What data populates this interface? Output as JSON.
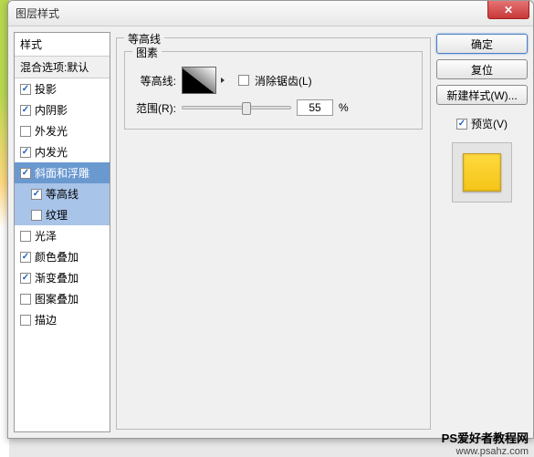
{
  "window": {
    "title": "图层样式"
  },
  "sidebar": {
    "header": "样式",
    "blend_header": "混合选项:默认",
    "items": [
      {
        "label": "投影",
        "checked": true
      },
      {
        "label": "内阴影",
        "checked": true
      },
      {
        "label": "外发光",
        "checked": false
      },
      {
        "label": "内发光",
        "checked": true
      },
      {
        "label": "斜面和浮雕",
        "checked": true,
        "selected": true
      },
      {
        "label": "等高线",
        "checked": true,
        "sub": true,
        "active": true
      },
      {
        "label": "纹理",
        "checked": false,
        "sub": true,
        "active": true
      },
      {
        "label": "光泽",
        "checked": false
      },
      {
        "label": "颜色叠加",
        "checked": true
      },
      {
        "label": "渐变叠加",
        "checked": true
      },
      {
        "label": "图案叠加",
        "checked": false
      },
      {
        "label": "描边",
        "checked": false
      }
    ]
  },
  "main": {
    "group_title": "等高线",
    "inner_title": "图素",
    "contour_label": "等高线:",
    "antialias_label": "消除锯齿(L)",
    "range_label": "范围(R):",
    "range_value": "55",
    "range_unit": "%"
  },
  "right": {
    "ok": "确定",
    "reset": "复位",
    "new_style": "新建样式(W)...",
    "preview": "预览(V)"
  },
  "watermark": {
    "line1": "PS爱好者教程网",
    "line2": "www.psahz.com"
  }
}
